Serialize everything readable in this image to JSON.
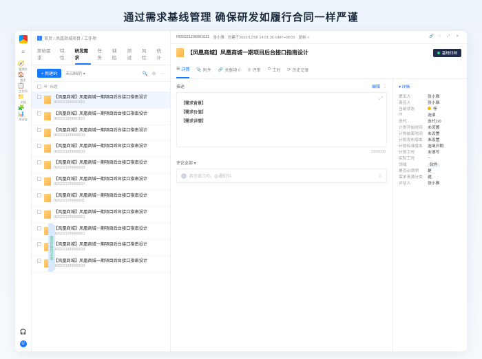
{
  "banner": "通过需求基线管理 确保研发如履行合同一样严谨",
  "rail": {
    "items": [
      {
        "icon": "🧭",
        "label": "管理台"
      },
      {
        "icon": "🏠",
        "label": "首页"
      },
      {
        "icon": "📋",
        "label": "工作项"
      },
      {
        "icon": "📁",
        "label": "文档"
      },
      {
        "icon": "🧩",
        "label": ""
      },
      {
        "icon": "📊",
        "label": "测试台"
      }
    ]
  },
  "crumb": "首页 / 凤凰商城项目 / 工作项",
  "tabsL": [
    "原始需求",
    "特性",
    "研发需求",
    "任务",
    "缺陷",
    "测试",
    "风险",
    "统计"
  ],
  "tabsL_active": 2,
  "newBtn": "+ 新建IR",
  "filter": "未归档的 ▾",
  "listHeader": "标题",
  "items": [
    {
      "title": "【凤凰商城】凤凰商城一期项目后台接口指南设计",
      "id": "IR20221206001021"
    },
    {
      "title": "【凤凰商城】凤凰商城一期项目后台接口指南设计",
      "id": "IR20221206001021"
    },
    {
      "title": "【凤凰商城】凤凰商城一期项目后台接口指南设计",
      "id": "IR20221205000019"
    },
    {
      "title": "【凤凰商城】凤凰商城一期项目后台接口指南设计",
      "id": "IR20221205000019"
    },
    {
      "title": "【凤凰商城】凤凰商城一期项目后台接口指南设计",
      "id": "IR20221205000019"
    },
    {
      "title": "【凤凰商城】凤凰商城一期项目后台接口指南设计",
      "id": "IR20221205000017"
    },
    {
      "title": "【凤凰商城】凤凰商城一期项目后台接口指南设计",
      "id": "IR20221205000011"
    },
    {
      "title": "【凤凰商城】凤凰商城一期项目后台接口指南设计",
      "id": "IR20221205000021"
    },
    {
      "title": "【凤凰商城】凤凰商城一期项目后台接口指南设计",
      "id": "IR20221205000021"
    },
    {
      "title": "【凤凰商城】凤凰商城一期项目后台接口指南设计",
      "id": "IR20221205000019"
    },
    {
      "title": "【凤凰商城】凤凰商城一期项目后台接口指南设计",
      "id": "IR20221205000019"
    }
  ],
  "detail": {
    "id": "IR20221206001021",
    "author": "张小雅",
    "created_label": "创建于2022/12/06 14:01:36 GMT+08:00",
    "copy": "复制 +",
    "title": "【凤凰商城】凤凰商城一期项目后台接口指南设计",
    "badge": "基线归档",
    "tabs": [
      "详情",
      "附件",
      "关联项 0",
      "评审",
      "工时",
      "历史记录"
    ],
    "tabs_icons": [
      "☰",
      "📎",
      "🔗",
      "◎",
      "⏱",
      "⟳"
    ],
    "tabs_active": 0,
    "descLabel": "描述",
    "editLink": "编辑",
    "outline": [
      "【需求背景】",
      "【需求价值】",
      "【需求详情】"
    ],
    "wordcount": "1900000",
    "commentLabel": "评论",
    "commentSort": "全部 ▾",
    "commentPlaceholder": "我也说几句，@通知TA"
  },
  "side": {
    "moreLabel": "▾ 详情",
    "fields": [
      {
        "k": "提出人",
        "v": "张小雅"
      },
      {
        "k": "责任人",
        "v": "张小雅"
      },
      {
        "k": "当前状态",
        "v": "停",
        "status": true
      },
      {
        "k": "PI",
        "v": "选填"
      },
      {
        "k": "迭代",
        "v": "迭代1/0"
      },
      {
        "k": "计划开始时间",
        "v": "未设置"
      },
      {
        "k": "计划结束时间",
        "v": "未设置"
      },
      {
        "k": "计划发布版本",
        "v": "未设置"
      },
      {
        "k": "计划标准版本",
        "v": "选填日期"
      },
      {
        "k": "计划工时",
        "v": "未填写"
      },
      {
        "k": "实际工时",
        "v": "--"
      },
      {
        "k": "领域",
        "v": "软件",
        "tag": true
      },
      {
        "k": "是否必须项",
        "v": "是"
      },
      {
        "k": "需求来源分类",
        "v": "建"
      },
      {
        "k": "评估人",
        "v": "张小雅"
      }
    ]
  }
}
